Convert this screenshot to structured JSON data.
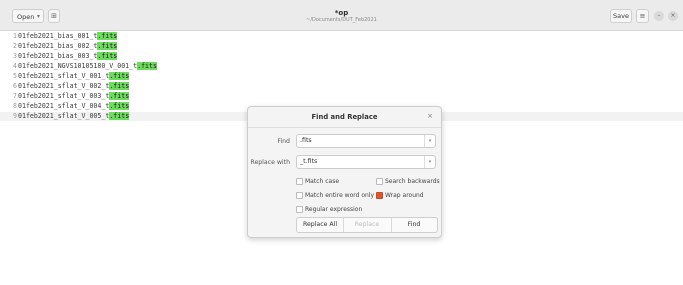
{
  "headerbar": {
    "open_label": "Open",
    "open_chevron": "▾",
    "new_tab_icon": "⊞",
    "title": "*op",
    "subtitle": "~/Documents/DUT_Feb2021",
    "save_label": "Save",
    "menu_icon": "≡",
    "minimize_icon": "–",
    "close_icon": "×"
  },
  "editor": {
    "lines": [
      {
        "no": "1",
        "text": "01feb2021_bias_001_t",
        "match": ".fits"
      },
      {
        "no": "2",
        "text": "01feb2021_bias_002_t",
        "match": ".fits"
      },
      {
        "no": "3",
        "text": "01feb2021_bias_003_t",
        "match": ".fits"
      },
      {
        "no": "4",
        "text": "01feb2021_NGVS10105180_V_001_t",
        "match": ".fits"
      },
      {
        "no": "5",
        "text": "01feb2021_sflat_V_001_t",
        "match": ".fits"
      },
      {
        "no": "6",
        "text": "01feb2021_sflat_V_002_t",
        "match": ".fits"
      },
      {
        "no": "7",
        "text": "01feb2021_sflat_V_003_t",
        "match": ".fits"
      },
      {
        "no": "8",
        "text": "01feb2021_sflat_V_004_t",
        "match": ".fits"
      },
      {
        "no": "9",
        "text": "01feb2021_sflat_V_005_t",
        "match": ".fits"
      }
    ],
    "highlight_color": "#6bdc5c"
  },
  "dialog": {
    "title": "Find and Replace",
    "close_icon": "×",
    "find_label": "Find",
    "find_value": ".fits",
    "replace_label": "Replace with",
    "replace_value": "_t.fits",
    "dropdown_icon": "▾",
    "options": {
      "match_case": "Match case",
      "search_backwards": "Search backwards",
      "match_entire_word": "Match entire word only",
      "wrap_around": "Wrap around",
      "regular_expression": "Regular expression"
    },
    "checked_color": "#e0552d",
    "replace_all_label": "Replace All",
    "replace_label_btn": "Replace",
    "find_btn_label": "Find"
  }
}
